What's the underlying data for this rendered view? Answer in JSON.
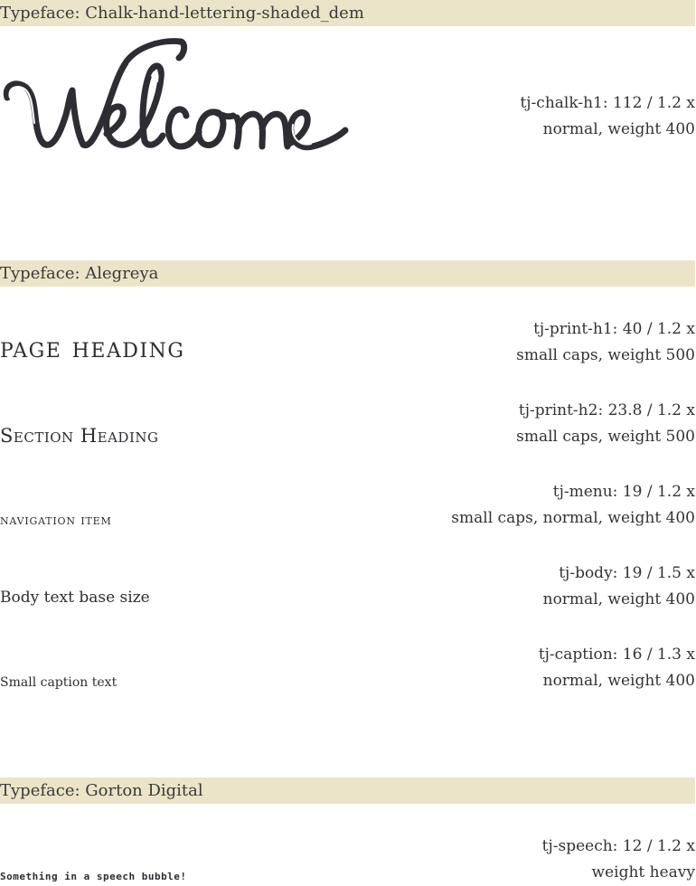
{
  "sections": [
    {
      "typeface_label": "Typeface: Chalk-hand-lettering-shaded_dem",
      "samples": [
        {
          "text": "Welcome",
          "spec_line1": "tj-chalk-h1: 112 / 1.2 x",
          "spec_line2": "normal, weight 400"
        }
      ]
    },
    {
      "typeface_label": "Typeface: Alegreya",
      "samples": [
        {
          "text": "Page Heading",
          "spec_line1": "tj-print-h1: 40 / 1.2 x",
          "spec_line2": "small caps, weight 500"
        },
        {
          "text": "Section Heading",
          "spec_line1": "tj-print-h2: 23.8 / 1.2 x",
          "spec_line2": "small caps, weight 500"
        },
        {
          "text": "navigation item",
          "spec_line1": "tj-menu: 19 / 1.2 x",
          "spec_line2": "small caps, normal, weight 400"
        },
        {
          "text": "Body text base size",
          "spec_line1": "tj-body: 19 / 1.5 x",
          "spec_line2": "normal, weight 400"
        },
        {
          "text": "Small caption text",
          "spec_line1": "tj-caption: 16 / 1.3 x",
          "spec_line2": "normal, weight 400"
        }
      ]
    },
    {
      "typeface_label": "Typeface: Gorton Digital",
      "samples": [
        {
          "text": "Something in a speech bubble!",
          "spec_line1": "tj-speech: 12 / 1.2 x",
          "spec_line2": "weight heavy"
        }
      ]
    }
  ],
  "colors": {
    "band_background": "#ebe4c8",
    "ink": "#2d2d33"
  }
}
